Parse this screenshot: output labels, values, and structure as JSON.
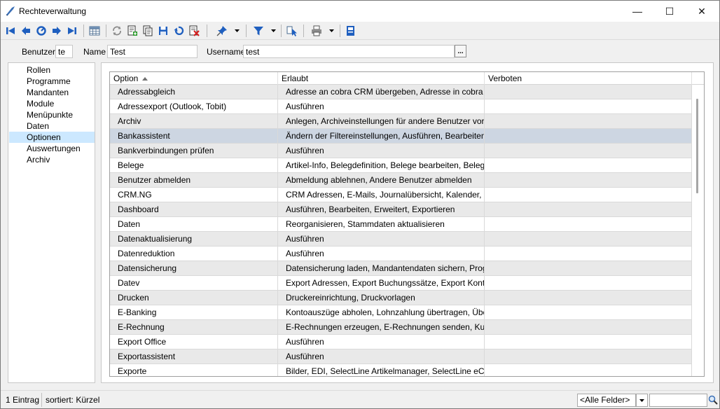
{
  "window": {
    "title": "Rechteverwaltung",
    "minimize_glyph": "—",
    "maximize_glyph": "☐",
    "close_glyph": "✕"
  },
  "toolbar": {
    "icons": [
      "first-record-icon",
      "previous-record-icon",
      "search-icon",
      "next-record-icon",
      "last-record-icon",
      "table-view-icon",
      "refresh-icon",
      "new-record-icon",
      "copy-record-icon",
      "save-icon",
      "undo-icon",
      "delete-icon",
      "pin-icon",
      "filter-icon",
      "navigate-icon",
      "print-icon",
      "info-icon"
    ]
  },
  "header": {
    "benutzer_label": "Benutzer",
    "benutzer_value": "te",
    "name_label": "Name",
    "name_value": "Test",
    "username_label": "Username",
    "username_value": "test",
    "browse_label": "..."
  },
  "nav": {
    "items": [
      {
        "label": "Rollen"
      },
      {
        "label": "Programme"
      },
      {
        "label": "Mandanten"
      },
      {
        "label": "Module"
      },
      {
        "label": "Menüpunkte"
      },
      {
        "label": "Daten"
      },
      {
        "label": "Optionen"
      },
      {
        "label": "Auswertungen"
      },
      {
        "label": "Archiv"
      }
    ],
    "selected": "Optionen"
  },
  "grid": {
    "columns": [
      "Option",
      "Erlaubt",
      "Verboten"
    ],
    "sorted_column": "Option",
    "rows": [
      {
        "option": "Adressabgleich",
        "erlaubt": "Adresse an cobra CRM übergeben, Adresse in cobra CR...",
        "verboten": ""
      },
      {
        "option": "Adressexport (Outlook, Tobit)",
        "erlaubt": "Ausführen",
        "verboten": ""
      },
      {
        "option": "Archiv",
        "erlaubt": "Anlegen, Archiveinstellungen für andere Benutzer vorneh...",
        "verboten": ""
      },
      {
        "option": "Bankassistent",
        "erlaubt": "Ändern der Filtereinstellungen, Ausführen, Bearbeiten, Dr...",
        "verboten": ""
      },
      {
        "option": "Bankverbindungen prüfen",
        "erlaubt": "Ausführen",
        "verboten": ""
      },
      {
        "option": "Belege",
        "erlaubt": "Artikel-Info, Belegdefinition, Belege bearbeiten, Belege mi...",
        "verboten": ""
      },
      {
        "option": "Benutzer abmelden",
        "erlaubt": "Abmeldung ablehnen, Andere Benutzer abmelden",
        "verboten": ""
      },
      {
        "option": "CRM.NG",
        "erlaubt": "CRM Adressen, E-Mails, Journalübersicht, Kalender, Kate...",
        "verboten": ""
      },
      {
        "option": "Dashboard",
        "erlaubt": "Ausführen, Bearbeiten, Erweitert, Exportieren",
        "verboten": ""
      },
      {
        "option": "Daten",
        "erlaubt": "Reorganisieren, Stammdaten aktualisieren",
        "verboten": ""
      },
      {
        "option": "Datenaktualisierung",
        "erlaubt": "Ausführen",
        "verboten": ""
      },
      {
        "option": "Datenreduktion",
        "erlaubt": "Ausführen",
        "verboten": ""
      },
      {
        "option": "Datensicherung",
        "erlaubt": "Datensicherung laden, Mandantendaten sichern, Progra...",
        "verboten": ""
      },
      {
        "option": "Datev",
        "erlaubt": "Export Adressen, Export Buchungssätze, Export Kontenb...",
        "verboten": ""
      },
      {
        "option": "Drucken",
        "erlaubt": "Druckereinrichtung, Druckvorlagen",
        "verboten": ""
      },
      {
        "option": "E-Banking",
        "erlaubt": "Kontoauszüge abholen, Lohnzahlung übertragen, Übertra...",
        "verboten": ""
      },
      {
        "option": "E-Rechnung",
        "erlaubt": "E-Rechnungen erzeugen, E-Rechnungen senden, Kund...",
        "verboten": ""
      },
      {
        "option": "Export Office",
        "erlaubt": "Ausführen",
        "verboten": ""
      },
      {
        "option": "Exportassistent",
        "erlaubt": "Ausführen",
        "verboten": ""
      },
      {
        "option": "Exporte",
        "erlaubt": "Bilder, EDI, SelectLine Artikelmanager, SelectLine eCom...",
        "verboten": ""
      }
    ],
    "selected_row": "Bankassistent"
  },
  "status": {
    "count": "1 Eintrag",
    "sort": "sortiert: Kürzel",
    "field_select": "<Alle Felder>",
    "search_value": ""
  },
  "colors": {
    "selected_nav": "#cce8ff",
    "selected_row": "#cdd6e2",
    "alt_row": "#e9e9e9"
  }
}
